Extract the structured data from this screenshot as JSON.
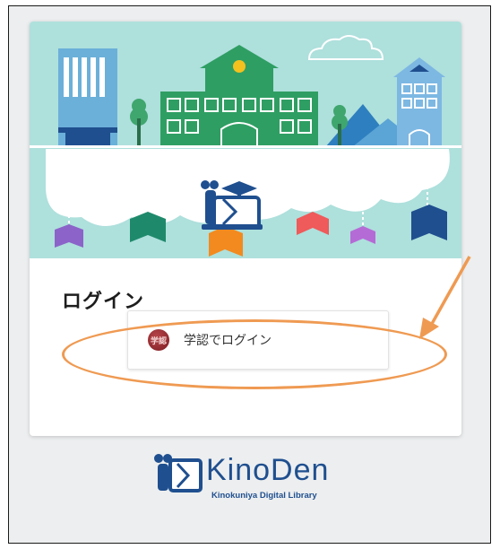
{
  "login": {
    "title": "ログイン",
    "gakunin_button_label": "学認でログイン",
    "gakunin_logo_text": "学認"
  },
  "brand": {
    "name": "KinoDen",
    "subtitle": "Kinokuniya Digital Library"
  },
  "annotation": {
    "highlight_color": "#ef9a52"
  },
  "colors": {
    "hero_sky": "#aee0dc",
    "brand_blue": "#1f4f8f",
    "card_bg": "#ffffff",
    "page_bg": "#eceeef"
  }
}
